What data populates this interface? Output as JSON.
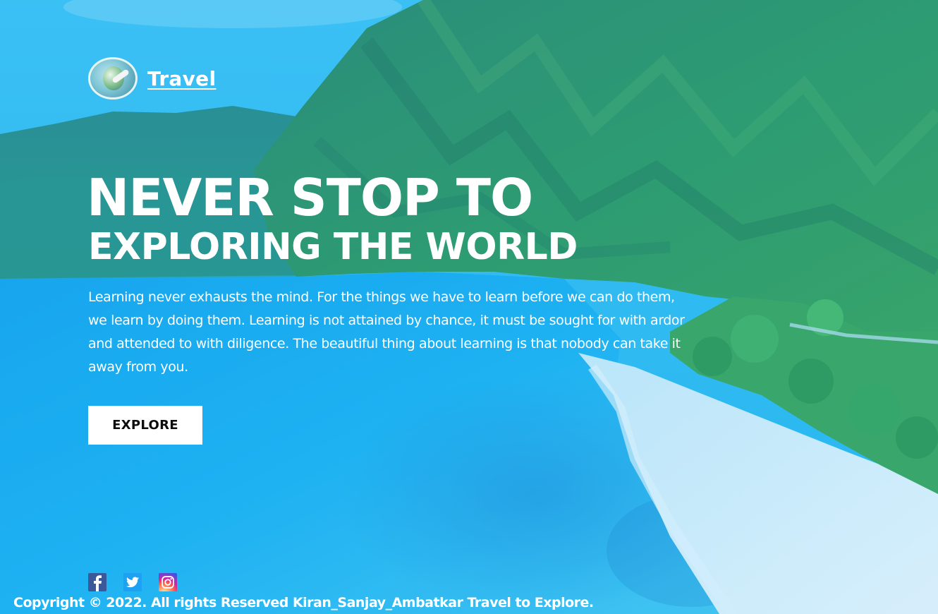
{
  "brand": {
    "logo_icon": "globe-plane-logo-icon",
    "name": "Travel"
  },
  "hero": {
    "headline_line1": "NEVER STOP TO",
    "headline_line2": "EXPLORING THE WORLD",
    "paragraph": "Learning never exhausts the mind. For the things we have to learn before we can do them, we learn by doing them. Learning is not attained by chance, it must be sought for with ardor and attended to with diligence. The beautiful thing about learning is that nobody can take it away from you.",
    "cta_label": "EXPLORE"
  },
  "social": {
    "icons": [
      "facebook-icon",
      "twitter-icon",
      "instagram-icon"
    ]
  },
  "footer": {
    "copyright": "Copyright © 2022. All rights Reserved Kiran_Sanjay_Ambatkar Travel to Explore."
  },
  "colors": {
    "overlay_blue": "#1fb6f0",
    "mountain_green": "#2f8a5a",
    "beach_sand": "#e6f4fb",
    "button_bg": "#ffffff",
    "button_text": "#0d0d0d"
  }
}
